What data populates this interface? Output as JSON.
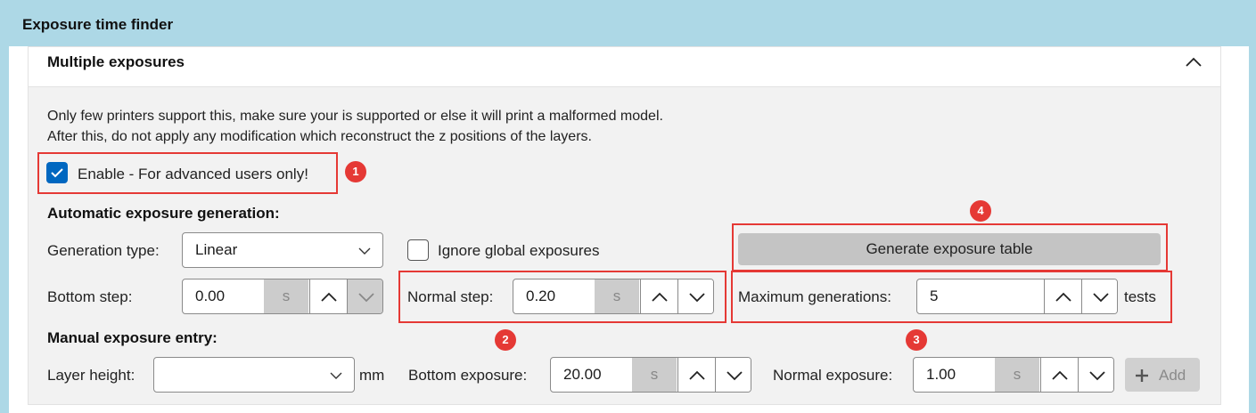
{
  "header": {
    "title": "Exposure time finder"
  },
  "section": {
    "title": "Multiple exposures",
    "description_lines": [
      "Only few printers support this, make sure your is supported or else it will print a malformed model.",
      "After this, do not apply any modification which reconstruct the z positions of the layers."
    ],
    "enable_label": "Enable - For advanced users only!",
    "enable_checked": true
  },
  "auto": {
    "heading": "Automatic exposure generation:",
    "generation_type_label": "Generation type:",
    "generation_type_value": "Linear",
    "ignore_global_label": "Ignore global exposures",
    "generate_button": "Generate exposure table",
    "bottom_step_label": "Bottom step:",
    "bottom_step_value": "0.00",
    "bottom_step_unit": "s",
    "normal_step_label": "Normal step:",
    "normal_step_value": "0.20",
    "normal_step_unit": "s",
    "max_gen_label": "Maximum generations:",
    "max_gen_value": "5",
    "max_gen_unit": "tests"
  },
  "manual": {
    "heading": "Manual exposure entry:",
    "layer_height_label": "Layer height:",
    "layer_height_value": "",
    "layer_height_unit": "mm",
    "bottom_exposure_label": "Bottom exposure:",
    "bottom_exposure_value": "20.00",
    "bottom_exposure_unit": "s",
    "normal_exposure_label": "Normal exposure:",
    "normal_exposure_value": "1.00",
    "normal_exposure_unit": "s",
    "add_button": "Add"
  },
  "annotations": [
    "1",
    "2",
    "3",
    "4"
  ],
  "colors": {
    "accent": "#0067c0",
    "highlight": "#e53935",
    "header_bg": "#add8e6"
  }
}
